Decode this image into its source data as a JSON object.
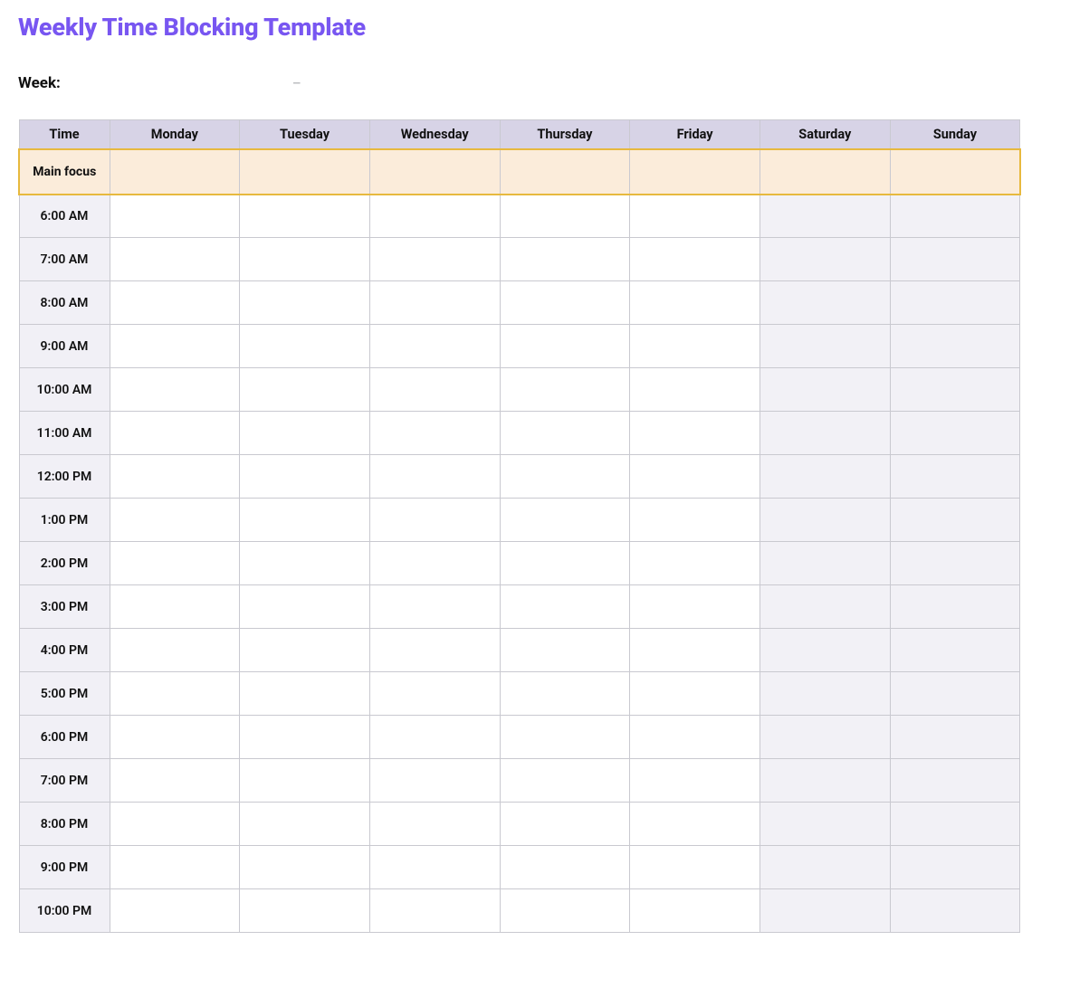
{
  "title": "Weekly Time Blocking Template",
  "week": {
    "label": "Week:",
    "start_value": "",
    "dash": "–",
    "end_value": ""
  },
  "columns": {
    "time_header": "Time",
    "days": [
      "Monday",
      "Tuesday",
      "Wednesday",
      "Thursday",
      "Friday",
      "Saturday",
      "Sunday"
    ]
  },
  "weekend_day_indices": [
    5,
    6
  ],
  "focus_row": {
    "label": "Main focus",
    "values": [
      "",
      "",
      "",
      "",
      "",
      "",
      ""
    ]
  },
  "time_slots": [
    "6:00 AM",
    "7:00 AM",
    "8:00 AM",
    "9:00 AM",
    "10:00 AM",
    "11:00 AM",
    "12:00 PM",
    "1:00 PM",
    "2:00 PM",
    "3:00 PM",
    "4:00 PM",
    "5:00 PM",
    "6:00 PM",
    "7:00 PM",
    "8:00 PM",
    "9:00 PM",
    "10:00 PM"
  ],
  "grid_values": [
    [
      "",
      "",
      "",
      "",
      "",
      "",
      ""
    ],
    [
      "",
      "",
      "",
      "",
      "",
      "",
      ""
    ],
    [
      "",
      "",
      "",
      "",
      "",
      "",
      ""
    ],
    [
      "",
      "",
      "",
      "",
      "",
      "",
      ""
    ],
    [
      "",
      "",
      "",
      "",
      "",
      "",
      ""
    ],
    [
      "",
      "",
      "",
      "",
      "",
      "",
      ""
    ],
    [
      "",
      "",
      "",
      "",
      "",
      "",
      ""
    ],
    [
      "",
      "",
      "",
      "",
      "",
      "",
      ""
    ],
    [
      "",
      "",
      "",
      "",
      "",
      "",
      ""
    ],
    [
      "",
      "",
      "",
      "",
      "",
      "",
      ""
    ],
    [
      "",
      "",
      "",
      "",
      "",
      "",
      ""
    ],
    [
      "",
      "",
      "",
      "",
      "",
      "",
      ""
    ],
    [
      "",
      "",
      "",
      "",
      "",
      "",
      ""
    ],
    [
      "",
      "",
      "",
      "",
      "",
      "",
      ""
    ],
    [
      "",
      "",
      "",
      "",
      "",
      "",
      ""
    ],
    [
      "",
      "",
      "",
      "",
      "",
      "",
      ""
    ],
    [
      "",
      "",
      "",
      "",
      "",
      "",
      ""
    ]
  ]
}
